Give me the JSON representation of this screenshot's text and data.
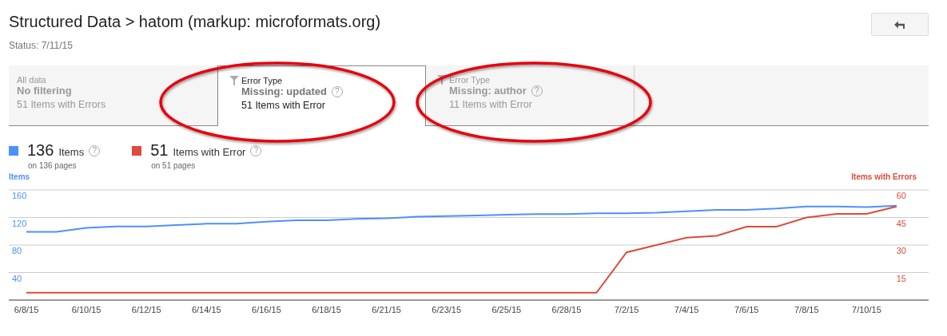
{
  "header": {
    "title": "Structured Data > hatom (markup: microformats.org)",
    "status": "Status: 7/11/15",
    "back_button": {
      "kind": "back"
    }
  },
  "filters": [
    {
      "kind": "all",
      "label": "All data",
      "title": "No filtering",
      "count": "51 Items with Errors",
      "selected": false,
      "highlighted": false
    },
    {
      "kind": "filter",
      "label": "Error Type",
      "title": "Missing: updated",
      "help": "?",
      "count": "51 Items with Error",
      "selected": true,
      "highlighted": true
    },
    {
      "kind": "filter",
      "label": "Error Type",
      "title": "Missing: author",
      "help": "?",
      "count": "11 Items with Error",
      "selected": false,
      "highlighted": true
    }
  ],
  "legend": [
    {
      "value": "136",
      "label": "Items",
      "help": "?",
      "sub": "on 136 pages",
      "color": "#4d90fe"
    },
    {
      "value": "51",
      "label": "Items with Error",
      "help": "?",
      "sub": "on 51 pages",
      "color": "#dd4b39"
    }
  ],
  "chart": {
    "chart_data": {
      "type": "line",
      "grid": true,
      "categories": [
        "6/8/15",
        null,
        "6/10/15",
        null,
        "6/12/15",
        null,
        "6/14/15",
        null,
        "6/16/15",
        null,
        "6/18/15",
        null,
        "6/21/15",
        null,
        "6/23/15",
        null,
        "6/25/15",
        null,
        "6/28/15",
        null,
        "7/2/15",
        null,
        "7/4/15",
        null,
        "7/6/15",
        null,
        "7/8/15",
        null,
        "7/10/15",
        null
      ],
      "ylim": [
        0,
        160
      ],
      "yticks": [
        40,
        80,
        120,
        160
      ],
      "y2lim": [
        0,
        60
      ],
      "y2ticks": [
        15,
        30,
        45,
        60
      ],
      "series": [
        {
          "name": "Items",
          "color": "#4d90fe",
          "values": [
            99,
            99,
            105,
            107,
            107,
            109,
            111,
            111,
            114,
            116,
            116,
            118,
            119,
            121,
            122,
            123,
            124,
            125,
            125,
            126,
            126,
            127,
            129,
            131,
            131,
            133,
            136,
            136,
            135,
            137
          ]
        },
        {
          "name": "Items with Errors",
          "color": "#dd4b39",
          "axis": "y2",
          "values": [
            4,
            4,
            4,
            4,
            4,
            4,
            4,
            4,
            4,
            4,
            4,
            4,
            4,
            4,
            4,
            4,
            4,
            4,
            4,
            4,
            26,
            30,
            34,
            35,
            40,
            40,
            45,
            47,
            47,
            51
          ]
        }
      ]
    }
  }
}
